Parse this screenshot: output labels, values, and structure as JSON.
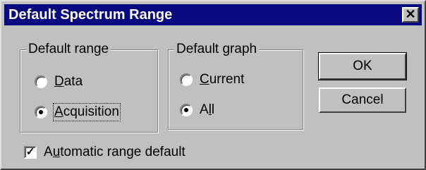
{
  "dialog": {
    "title": "Default Spectrum Range",
    "close_label": "✕"
  },
  "default_range": {
    "legend": "Default range",
    "options": [
      {
        "pre": "",
        "u": "D",
        "post": "ata",
        "checked": false
      },
      {
        "pre": "",
        "u": "A",
        "post": "cquisition",
        "checked": true
      }
    ]
  },
  "default_graph": {
    "legend": "Default graph",
    "options": [
      {
        "pre": "",
        "u": "C",
        "post": "urrent",
        "checked": false
      },
      {
        "pre": "A",
        "u": "l",
        "post": "l",
        "checked": true
      }
    ]
  },
  "buttons": {
    "ok_label": "OK",
    "cancel_label": "Cancel"
  },
  "automatic": {
    "pre": "A",
    "u": "u",
    "post": "tomatic range default",
    "checked": true,
    "check_glyph": "✓"
  }
}
